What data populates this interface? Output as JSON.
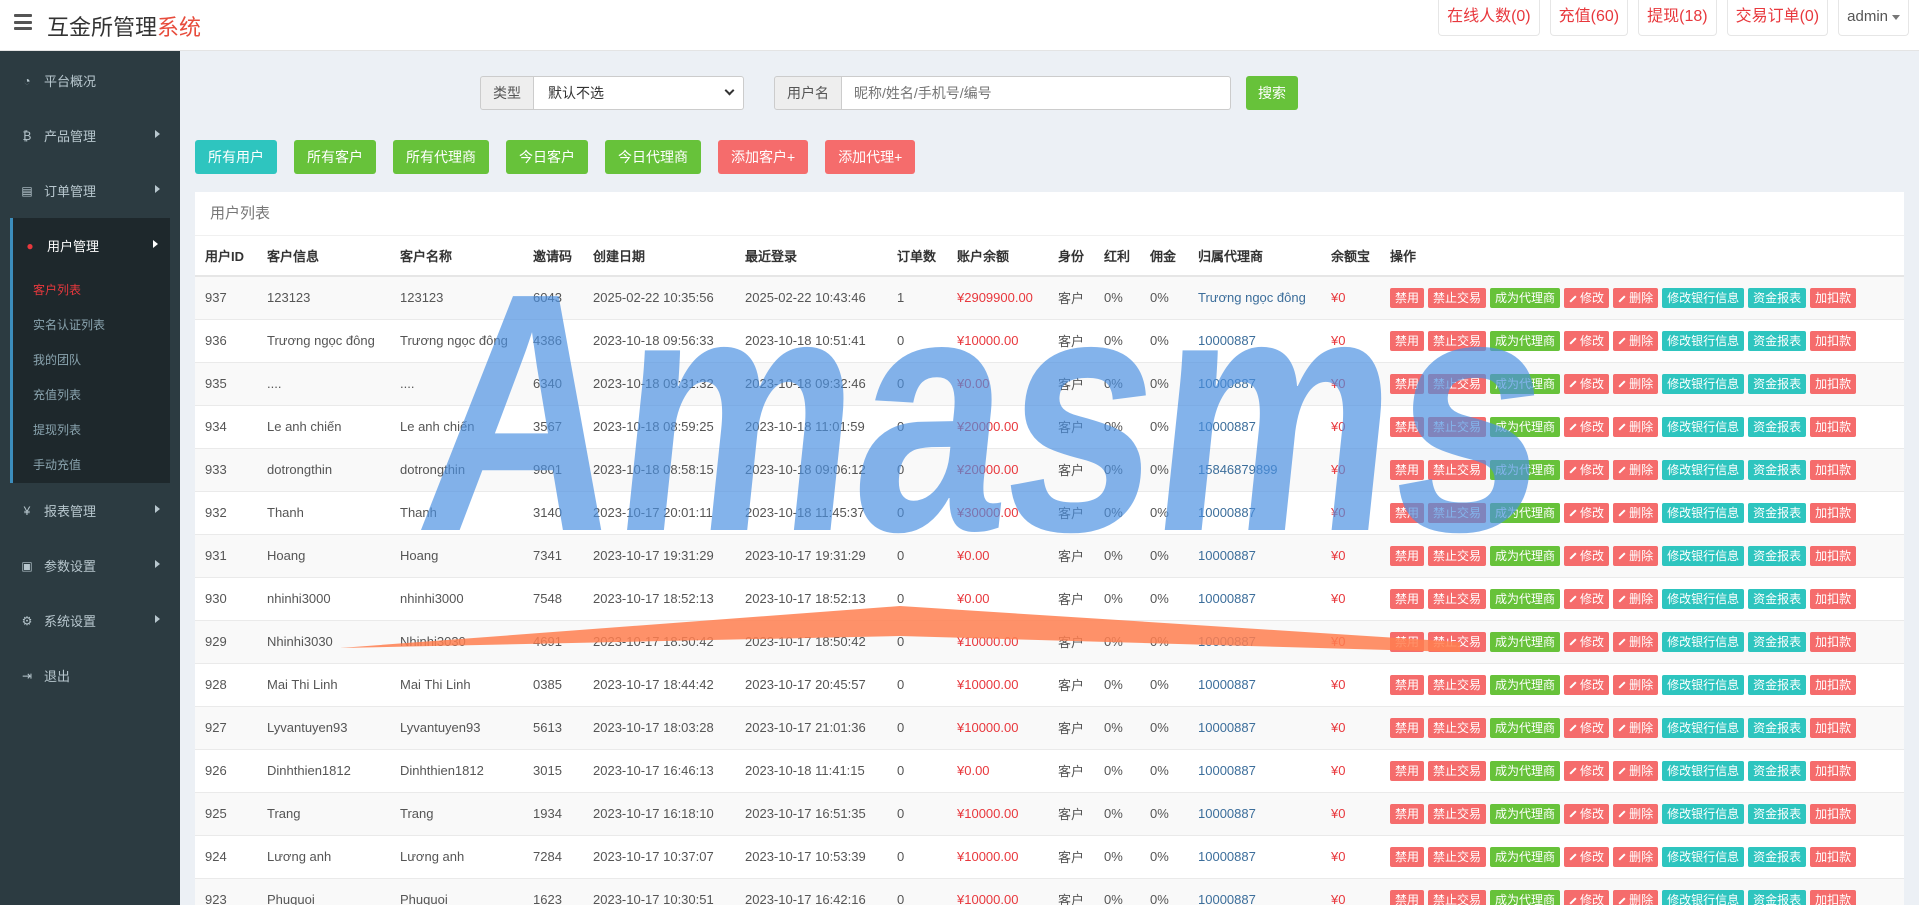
{
  "header": {
    "title_main": "互金所管理",
    "title_accent": "系统",
    "buttons": [
      {
        "label": "在线人数(0)"
      },
      {
        "label": "充值(60)"
      },
      {
        "label": "提现(18)"
      },
      {
        "label": "交易订单(0)"
      }
    ],
    "user": "admin"
  },
  "sidebar": {
    "items": [
      {
        "label": "平台概况",
        "icon": "dashboard-icon"
      },
      {
        "label": "产品管理",
        "icon": "bitcoin-icon"
      },
      {
        "label": "订单管理",
        "icon": "order-icon"
      },
      {
        "label": "用户管理",
        "icon": "user-icon"
      },
      {
        "label": "报表管理",
        "icon": "yen-icon"
      },
      {
        "label": "参数设置",
        "icon": "params-icon"
      },
      {
        "label": "系统设置",
        "icon": "gear-icon"
      },
      {
        "label": "退出",
        "icon": "logout-icon"
      }
    ],
    "subitems": [
      {
        "label": "客户列表",
        "active": true
      },
      {
        "label": "实名认证列表"
      },
      {
        "label": "我的团队"
      },
      {
        "label": "充值列表"
      },
      {
        "label": "提现列表"
      },
      {
        "label": "手动充值"
      }
    ]
  },
  "search": {
    "type_label": "类型",
    "type_value": "默认不选",
    "username_label": "用户名",
    "username_placeholder": "昵称/姓名/手机号/编号",
    "button": "搜索"
  },
  "filters": [
    {
      "label": "所有用户",
      "color": "teal"
    },
    {
      "label": "所有客户",
      "color": "green"
    },
    {
      "label": "所有代理商",
      "color": "green"
    },
    {
      "label": "今日客户",
      "color": "green"
    },
    {
      "label": "今日代理商",
      "color": "green"
    },
    {
      "label": "添加客户+",
      "color": "red"
    },
    {
      "label": "添加代理+",
      "color": "red"
    }
  ],
  "panel_title": "用户列表",
  "columns": [
    "用户ID",
    "客户信息",
    "客户名称",
    "邀请码",
    "创建日期",
    "最近登录",
    "订单数",
    "账户余额",
    "身份",
    "红利",
    "佣金",
    "归属代理商",
    "余额宝",
    "操作"
  ],
  "actions": [
    "禁用",
    "禁止交易",
    "成为代理商",
    "修改",
    "删除",
    "修改银行信息",
    "资金报表",
    "加扣款"
  ],
  "rows": [
    {
      "id": "937",
      "info": "123123",
      "name": "123123",
      "code": "6043",
      "created": "2025-02-22 10:35:56",
      "login": "2025-02-22 10:43:46",
      "orders": "1",
      "balance": "¥2909900.00",
      "role": "客户",
      "bonus": "0%",
      "commission": "0%",
      "agent": "Trương ngọc đông",
      "yebao": "¥0"
    },
    {
      "id": "936",
      "info": "Trương ngọc đông",
      "name": "Trương ngọc đông",
      "code": "4386",
      "created": "2023-10-18 09:56:33",
      "login": "2023-10-18 10:51:41",
      "orders": "0",
      "balance": "¥10000.00",
      "role": "客户",
      "bonus": "0%",
      "commission": "0%",
      "agent": "10000887",
      "yebao": "¥0"
    },
    {
      "id": "935",
      "info": "....",
      "name": "....",
      "code": "6340",
      "created": "2023-10-18 09:31:32",
      "login": "2023-10-18 09:32:46",
      "orders": "0",
      "balance": "¥0.00",
      "role": "客户",
      "bonus": "0%",
      "commission": "0%",
      "agent": "10000887",
      "yebao": "¥0"
    },
    {
      "id": "934",
      "info": "Le anh chiến",
      "name": "Le anh chiến",
      "code": "3567",
      "created": "2023-10-18 08:59:25",
      "login": "2023-10-18 11:01:59",
      "orders": "0",
      "balance": "¥20000.00",
      "role": "客户",
      "bonus": "0%",
      "commission": "0%",
      "agent": "10000887",
      "yebao": "¥0"
    },
    {
      "id": "933",
      "info": "dotrongthin",
      "name": "dotrongthin",
      "code": "9801",
      "created": "2023-10-18 08:58:15",
      "login": "2023-10-18 09:06:12",
      "orders": "0",
      "balance": "¥20000.00",
      "role": "客户",
      "bonus": "0%",
      "commission": "0%",
      "agent": "15846879899",
      "yebao": "¥0"
    },
    {
      "id": "932",
      "info": "Thanh",
      "name": "Thanh",
      "code": "3140",
      "created": "2023-10-17 20:01:11",
      "login": "2023-10-18 11:45:37",
      "orders": "0",
      "balance": "¥30000.00",
      "role": "客户",
      "bonus": "0%",
      "commission": "0%",
      "agent": "10000887",
      "yebao": "¥0"
    },
    {
      "id": "931",
      "info": "Hoang",
      "name": "Hoang",
      "code": "7341",
      "created": "2023-10-17 19:31:29",
      "login": "2023-10-17 19:31:29",
      "orders": "0",
      "balance": "¥0.00",
      "role": "客户",
      "bonus": "0%",
      "commission": "0%",
      "agent": "10000887",
      "yebao": "¥0"
    },
    {
      "id": "930",
      "info": "nhinhi3000",
      "name": "nhinhi3000",
      "code": "7548",
      "created": "2023-10-17 18:52:13",
      "login": "2023-10-17 18:52:13",
      "orders": "0",
      "balance": "¥0.00",
      "role": "客户",
      "bonus": "0%",
      "commission": "0%",
      "agent": "10000887",
      "yebao": "¥0"
    },
    {
      "id": "929",
      "info": "Nhinhi3030",
      "name": "Nhinhi3030",
      "code": "4691",
      "created": "2023-10-17 18:50:42",
      "login": "2023-10-17 18:50:42",
      "orders": "0",
      "balance": "¥10000.00",
      "role": "客户",
      "bonus": "0%",
      "commission": "0%",
      "agent": "10000887",
      "yebao": "¥0"
    },
    {
      "id": "928",
      "info": "Mai Thi Linh",
      "name": "Mai Thi Linh",
      "code": "0385",
      "created": "2023-10-17 18:44:42",
      "login": "2023-10-17 20:45:57",
      "orders": "0",
      "balance": "¥10000.00",
      "role": "客户",
      "bonus": "0%",
      "commission": "0%",
      "agent": "10000887",
      "yebao": "¥0"
    },
    {
      "id": "927",
      "info": "Lyvantuyen93",
      "name": "Lyvantuyen93",
      "code": "5613",
      "created": "2023-10-17 18:03:28",
      "login": "2023-10-17 21:01:36",
      "orders": "0",
      "balance": "¥10000.00",
      "role": "客户",
      "bonus": "0%",
      "commission": "0%",
      "agent": "10000887",
      "yebao": "¥0"
    },
    {
      "id": "926",
      "info": "Dinhthien1812",
      "name": "Dinhthien1812",
      "code": "3015",
      "created": "2023-10-17 16:46:13",
      "login": "2023-10-18 11:41:15",
      "orders": "0",
      "balance": "¥0.00",
      "role": "客户",
      "bonus": "0%",
      "commission": "0%",
      "agent": "10000887",
      "yebao": "¥0"
    },
    {
      "id": "925",
      "info": "Trang",
      "name": "Trang",
      "code": "1934",
      "created": "2023-10-17 16:18:10",
      "login": "2023-10-17 16:51:35",
      "orders": "0",
      "balance": "¥10000.00",
      "role": "客户",
      "bonus": "0%",
      "commission": "0%",
      "agent": "10000887",
      "yebao": "¥0"
    },
    {
      "id": "924",
      "info": "Lương anh",
      "name": "Lương anh",
      "code": "7284",
      "created": "2023-10-17 10:37:07",
      "login": "2023-10-17 10:53:39",
      "orders": "0",
      "balance": "¥10000.00",
      "role": "客户",
      "bonus": "0%",
      "commission": "0%",
      "agent": "10000887",
      "yebao": "¥0"
    },
    {
      "id": "923",
      "info": "Phuquoi",
      "name": "Phuquoi",
      "code": "1623",
      "created": "2023-10-17 10:30:51",
      "login": "2023-10-17 16:42:16",
      "orders": "0",
      "balance": "¥10000.00",
      "role": "客户",
      "bonus": "0%",
      "commission": "0%",
      "agent": "10000887",
      "yebao": "¥0"
    }
  ],
  "watermark": {
    "text": "Amasms"
  }
}
